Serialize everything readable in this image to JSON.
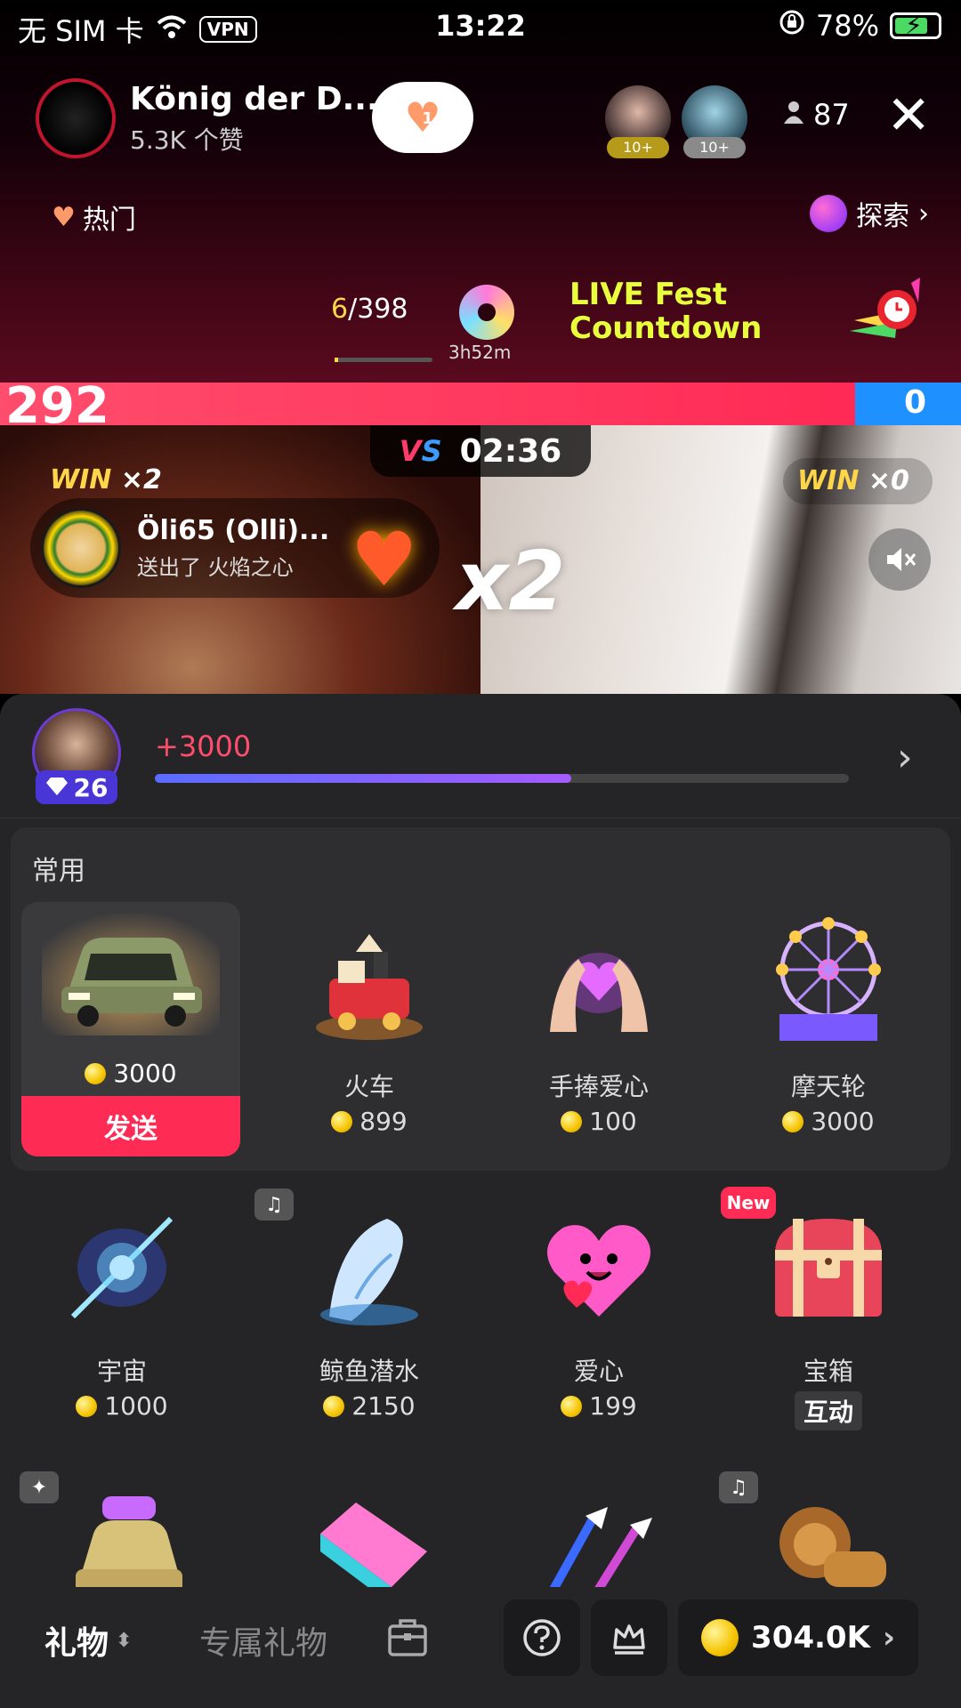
{
  "status_bar": {
    "carrier": "无 SIM 卡",
    "vpn": "VPN",
    "time": "13:22",
    "battery": "78%",
    "battery_level": 0.78
  },
  "host": {
    "name": "König der D...",
    "likes": "5.3K 个赞",
    "follow_count": "1"
  },
  "viewers": {
    "badge_1": "10+",
    "badge_2": "10+",
    "count": "87"
  },
  "hot_label": "热门",
  "explore_label": "探索",
  "ranking": {
    "current": "6",
    "total": "/398",
    "progress": 0.04,
    "timer": "3h52m",
    "event_line1": "LIVE Fest",
    "event_line2": "Countdown"
  },
  "pk": {
    "score_left": "292",
    "score_right": "0",
    "score_share_left": 0.89,
    "vs_label": "VS",
    "timer": "02:36",
    "win_left_label": "WIN",
    "win_left_count": "×2",
    "win_right_label": "WIN",
    "win_right_count": "×0",
    "gifter_name": "Öli65 (Olli)...",
    "gifter_message": "送出了 火焰之心",
    "multiplier": "x2"
  },
  "user_level": {
    "level": "26",
    "xp_gain": "+3000",
    "progress": 0.6
  },
  "frequent": {
    "title": "常用",
    "selected": {
      "price": "3000",
      "send_label": "发送"
    },
    "items": [
      {
        "name": "火车",
        "price": "899"
      },
      {
        "name": "手捧爱心",
        "price": "100"
      },
      {
        "name": "摩天轮",
        "price": "3000"
      }
    ]
  },
  "gifts_row2": [
    {
      "name": "宇宙",
      "price": "1000"
    },
    {
      "name": "鲸鱼潜水",
      "price": "2150"
    },
    {
      "name": "爱心",
      "price": "199"
    },
    {
      "name": "宝箱",
      "tag": "互动",
      "badge": "New"
    }
  ],
  "bottom_bar": {
    "tab_gift": "礼物",
    "tab_exclusive": "专属礼物",
    "balance": "304.0K"
  },
  "colors": {
    "accent_red": "#fe2c55",
    "pk_blue": "#1e90ff",
    "event_yellow": "#e8ff3c",
    "level_purple": "#4a36d6"
  }
}
